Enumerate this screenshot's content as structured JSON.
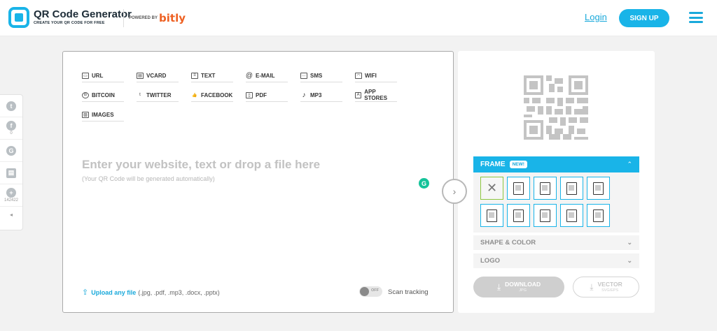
{
  "header": {
    "logo_title": "QR Code Generator",
    "logo_subtitle": "CREATE YOUR QR CODE FOR FREE",
    "powered_by": "POWERED BY",
    "powered_brand": "bitly",
    "login_label": "Login",
    "signup_label": "SIGN UP",
    "accent_color": "#19b4e8"
  },
  "share_bar": {
    "items": [
      {
        "icon": "twitter-icon",
        "glyph": "t",
        "count": ""
      },
      {
        "icon": "facebook-icon",
        "glyph": "f",
        "count": "0"
      },
      {
        "icon": "google-icon",
        "glyph": "G",
        "count": ""
      },
      {
        "icon": "print-icon",
        "glyph": "▤",
        "count": ""
      },
      {
        "icon": "plus-icon",
        "glyph": "+",
        "count": "142422"
      }
    ],
    "collapse_glyph": "◂"
  },
  "types": [
    {
      "label": "URL",
      "icon": "url-icon",
      "glyph": "▭"
    },
    {
      "label": "VCARD",
      "icon": "vcard-icon",
      "glyph": "▤"
    },
    {
      "label": "TEXT",
      "icon": "text-icon",
      "glyph": "≡"
    },
    {
      "label": "E-MAIL",
      "icon": "email-icon",
      "glyph": "@"
    },
    {
      "label": "SMS",
      "icon": "sms-icon",
      "glyph": "…"
    },
    {
      "label": "WIFI",
      "icon": "wifi-icon",
      "glyph": "◠"
    },
    {
      "label": "BITCOIN",
      "icon": "bitcoin-icon",
      "glyph": "B"
    },
    {
      "label": "TWITTER",
      "icon": "twitter-icon",
      "glyph": "t"
    },
    {
      "label": "FACEBOOK",
      "icon": "facebook-like-icon",
      "glyph": "👍"
    },
    {
      "label": "PDF",
      "icon": "pdf-icon",
      "glyph": "▯"
    },
    {
      "label": "MP3",
      "icon": "music-icon",
      "glyph": "♪"
    },
    {
      "label": "APP STORES",
      "icon": "app-store-icon",
      "glyph": "A"
    },
    {
      "label": "IMAGES",
      "icon": "image-icon",
      "glyph": "▨"
    }
  ],
  "input": {
    "placeholder_title": "Enter your website, text or drop a file here",
    "placeholder_sub": "(Your QR Code will be generated automatically)"
  },
  "grammarly_glyph": "G",
  "next_glyph": "›",
  "upload": {
    "link_label": "Upload any file",
    "formats": "(.jpg, .pdf, .mp3, .docx, .pptx)",
    "glyph": "⇪"
  },
  "scan_tracking": {
    "toggle_state": "OFF",
    "label": "Scan tracking"
  },
  "frame": {
    "title": "FRAME",
    "badge": "NEW!",
    "chevron": "⌃",
    "none_glyph": "✕"
  },
  "shape_color": {
    "title": "SHAPE & COLOR",
    "chevron": "⌄"
  },
  "logo_section": {
    "title": "LOGO",
    "chevron": "⌄"
  },
  "download": {
    "label": "DOWNLOAD",
    "sub": "JPG",
    "glyph": "⤓"
  },
  "vector": {
    "label": "VECTOR",
    "sub": "SVG/EPS",
    "glyph": "⤓"
  }
}
